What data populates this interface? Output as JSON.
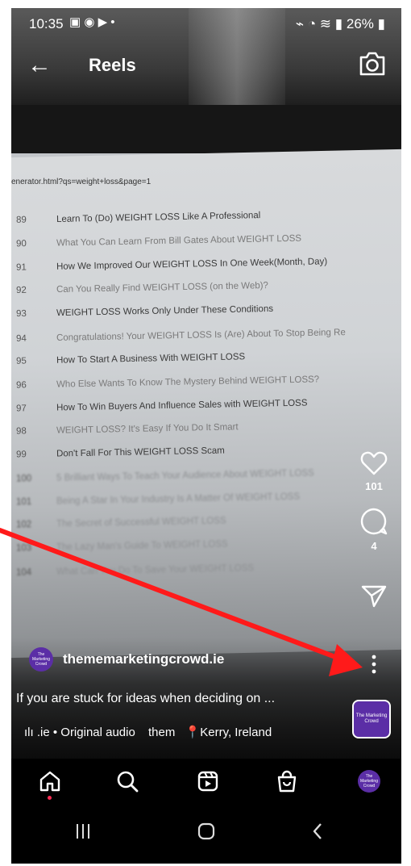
{
  "status_bar": {
    "time": "10:35",
    "battery": "26%"
  },
  "header": {
    "title": "Reels"
  },
  "video": {
    "url_text": "enerator.html?qs=weight+loss&page=1",
    "rows": [
      {
        "num": "89",
        "text": "Learn To (Do) WEIGHT LOSS Like A Professional"
      },
      {
        "num": "90",
        "text": "What You Can Learn From Bill Gates About WEIGHT LOSS"
      },
      {
        "num": "91",
        "text": "How We Improved Our WEIGHT LOSS In One Week(Month, Day)"
      },
      {
        "num": "92",
        "text": "Can You Really Find WEIGHT LOSS (on the Web)?"
      },
      {
        "num": "93",
        "text": "WEIGHT LOSS Works Only Under These Conditions"
      },
      {
        "num": "94",
        "text": "Congratulations! Your WEIGHT LOSS Is (Are) About To Stop Being Re"
      },
      {
        "num": "95",
        "text": "How To Start A Business With WEIGHT LOSS"
      },
      {
        "num": "96",
        "text": "Who Else Wants To Know The Mystery Behind WEIGHT LOSS?"
      },
      {
        "num": "97",
        "text": "How To Win Buyers And Influence Sales with WEIGHT LOSS"
      },
      {
        "num": "98",
        "text": "WEIGHT LOSS? It's Easy If You Do It Smart"
      },
      {
        "num": "99",
        "text": "Don't Fall For This WEIGHT LOSS Scam"
      },
      {
        "num": "100",
        "text": "5 Brilliant Ways To Teach Your Audience About WEIGHT LOSS"
      },
      {
        "num": "101",
        "text": "Being A Star In Your Industry Is A Matter Of WEIGHT LOSS"
      },
      {
        "num": "102",
        "text": "The Secret of Successful WEIGHT LOSS"
      },
      {
        "num": "103",
        "text": "The Lazy Man's Guide To WEIGHT LOSS"
      },
      {
        "num": "104",
        "text": "What Can You Do To Save Your WEIGHT LOSS"
      }
    ]
  },
  "actions": {
    "likes": "101",
    "comments": "4"
  },
  "post": {
    "avatar_text": "The Marketing Crowd",
    "username": "thememarketingcrowd.ie",
    "caption": "If you are stuck for ideas when deciding on ...",
    "audio": ".ie • Original audio",
    "tag": "them",
    "location": "Kerry, Ireland"
  },
  "album_text": "The Marketing Crowd",
  "nav_avatar_text": "The Marketing Crowd",
  "colors": {
    "annotation_arrow": "#ff1a1a",
    "brand_purple": "#5b2ea6",
    "notification_dot": "#ff2d55"
  },
  "icons": [
    "back-arrow-icon",
    "camera-icon",
    "heart-icon",
    "comment-icon",
    "send-icon",
    "more-icon",
    "home-icon",
    "search-icon",
    "reels-icon",
    "shop-icon"
  ]
}
